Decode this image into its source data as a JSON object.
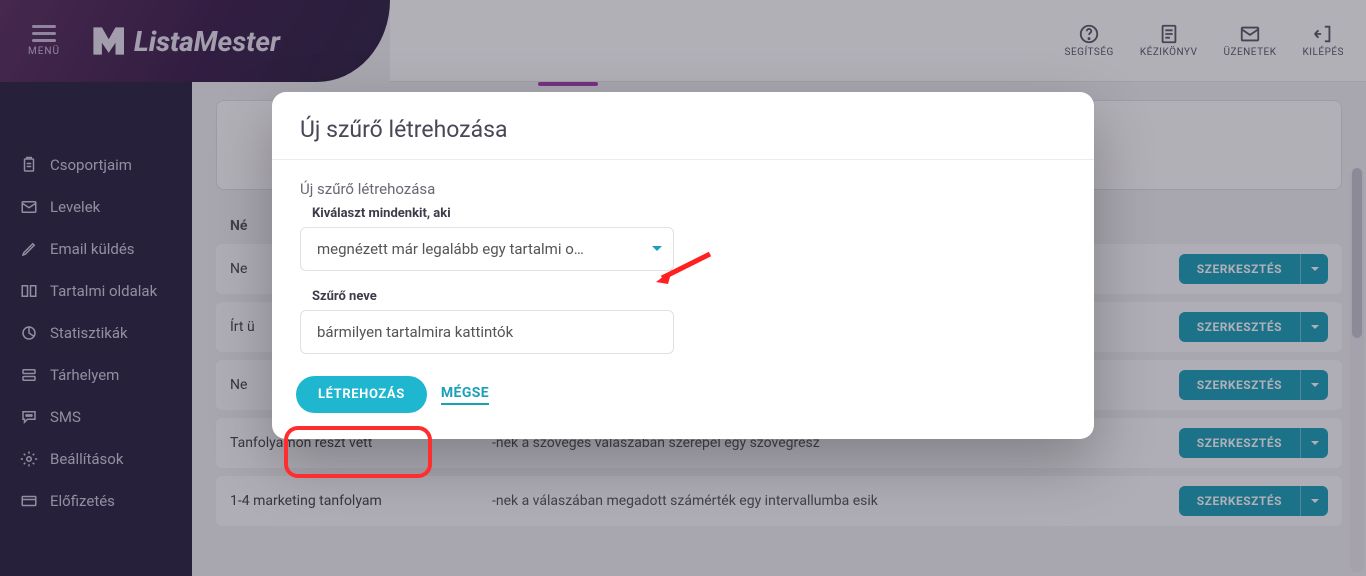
{
  "header": {
    "menu_label": "MENÜ",
    "brand_text_1": "Lista",
    "brand_text_2": "Mester",
    "icons": {
      "help": "SEGÍTSÉG",
      "manual": "KÉZIKÖNYV",
      "messages": "ÜZENETEK",
      "logout": "KILÉPÉS"
    }
  },
  "sidebar": {
    "items": [
      {
        "label": "Csoportjaim"
      },
      {
        "label": "Levelek"
      },
      {
        "label": "Email küldés"
      },
      {
        "label": "Tartalmi oldalak"
      },
      {
        "label": "Statisztikák"
      },
      {
        "label": "Tárhelyem"
      },
      {
        "label": "SMS"
      },
      {
        "label": "Beállítások"
      },
      {
        "label": "Előfizetés"
      }
    ]
  },
  "main": {
    "name_header": "Né",
    "rows": [
      {
        "c1": "Ne",
        "c2": "",
        "action": "SZERKESZTÉS"
      },
      {
        "c1": "Írt ü",
        "c2": "",
        "action": "SZERKESZTÉS"
      },
      {
        "c1": "Ne",
        "c2": "",
        "action": "SZERKESZTÉS"
      },
      {
        "c1": "Tanfolyamon részt vett",
        "c2": "-nek a szöveges válaszában szerepel egy szövegrész",
        "action": "SZERKESZTÉS"
      },
      {
        "c1": "1-4 marketing tanfolyam",
        "c2": "-nek a válaszában megadott számérték egy intervallumba esik",
        "action": "SZERKESZTÉS"
      }
    ]
  },
  "modal": {
    "title": "Új szűrő létrehozása",
    "subtitle": "Új szűrő létrehozása",
    "select_label": "Kiválaszt mindenkit, aki",
    "select_value": "megnézett már legalább egy tartalmi o…",
    "name_label": "Szűrő neve",
    "name_value": "bármilyen tartalmira kattintók",
    "create_btn": "LÉTREHOZÁS",
    "cancel_btn": "MÉGSE"
  }
}
